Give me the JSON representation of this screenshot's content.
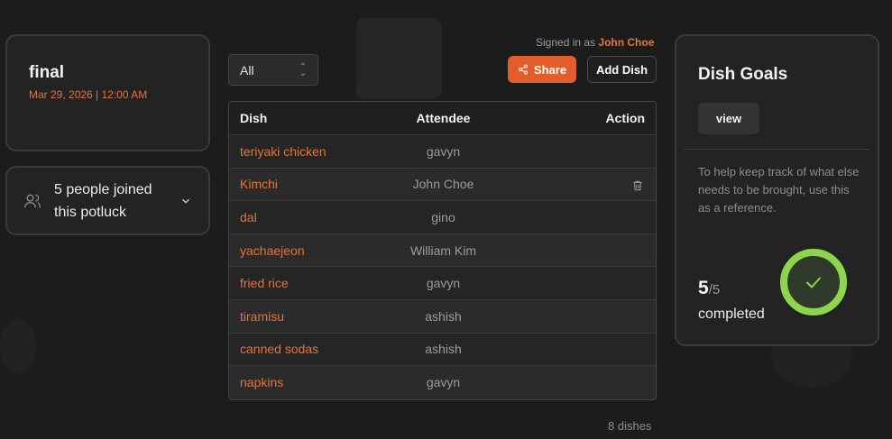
{
  "event": {
    "title": "final",
    "datetime": "Mar 29, 2026 | 12:00 AM"
  },
  "attendees": {
    "summary_line1": "5 people joined",
    "summary_line2": "this potluck"
  },
  "filter": {
    "selected": "All"
  },
  "session": {
    "signed_in_prefix": "Signed in as",
    "user_name": "John Choe"
  },
  "toolbar": {
    "share_label": "Share",
    "add_dish_label": "Add Dish"
  },
  "table": {
    "headers": {
      "dish": "Dish",
      "attendee": "Attendee",
      "action": "Action"
    },
    "rows": [
      {
        "dish": "teriyaki chicken",
        "attendee": "gavyn",
        "deletable": false
      },
      {
        "dish": "Kimchi",
        "attendee": "John Choe",
        "deletable": true
      },
      {
        "dish": "dal",
        "attendee": "gino",
        "deletable": false
      },
      {
        "dish": "yachaejeon",
        "attendee": "William Kim",
        "deletable": false
      },
      {
        "dish": "fried rice",
        "attendee": "gavyn",
        "deletable": false
      },
      {
        "dish": "tiramisu",
        "attendee": "ashish",
        "deletable": false
      },
      {
        "dish": "canned sodas",
        "attendee": "ashish",
        "deletable": false
      },
      {
        "dish": "napkins",
        "attendee": "gavyn",
        "deletable": false
      }
    ],
    "count_label": "8 dishes"
  },
  "goals": {
    "title": "Dish Goals",
    "view_label": "view",
    "help_text": "To help keep track of what else needs to be brought, use this as a reference.",
    "completed_count": "5",
    "total": "/5",
    "completed_label": "completed",
    "progress_fraction": 1.0
  },
  "colors": {
    "accent": "#e3743a",
    "share_button": "#e35d2a",
    "progress_ring": "#8ed44c"
  }
}
